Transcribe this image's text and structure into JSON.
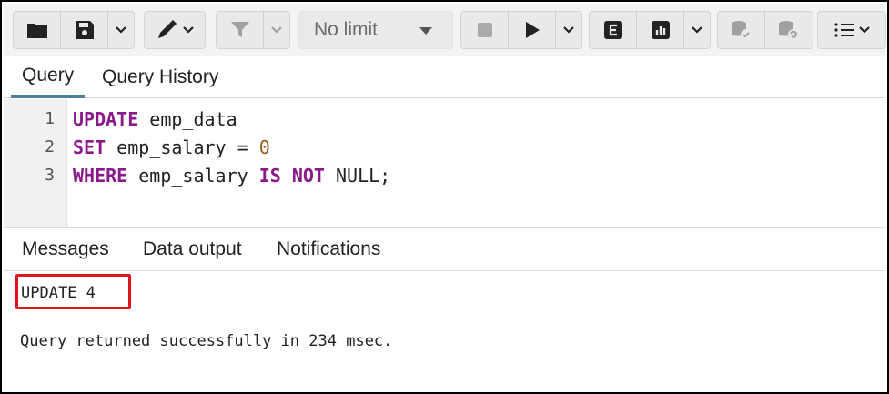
{
  "toolbar": {
    "limit_label": "No limit",
    "icons": [
      "folder-icon",
      "save-icon",
      "chevron-down-icon",
      "pen-icon",
      "filter-icon",
      "stop-icon",
      "play-icon",
      "explain-icon",
      "explain-analyze-icon",
      "commit-icon",
      "rollback-icon",
      "macros-icon"
    ]
  },
  "editor_tabs": [
    {
      "label": "Query",
      "active": true
    },
    {
      "label": "Query History",
      "active": false
    }
  ],
  "editor": {
    "line_numbers": [
      "1",
      "2",
      "3"
    ],
    "lines": [
      {
        "kw1": "UPDATE",
        "rest": " emp_data"
      },
      {
        "kw1": "SET",
        "rest": " emp_salary = ",
        "num": "0"
      },
      {
        "kw1": "WHERE",
        "mid": " emp_salary ",
        "kw2": "IS NOT",
        "tail": " NULL;"
      }
    ]
  },
  "result_tabs": [
    {
      "label": "Messages",
      "active": true
    },
    {
      "label": "Data output",
      "active": false
    },
    {
      "label": "Notifications",
      "active": false
    }
  ],
  "messages": {
    "result": "UPDATE 4",
    "status": "Query returned successfully in 234 msec."
  },
  "colors": {
    "keyword": "#8a1a8a",
    "number": "#9c5a1f",
    "active_tab": "#4a7e9e",
    "highlight_box": "#e0141e"
  }
}
